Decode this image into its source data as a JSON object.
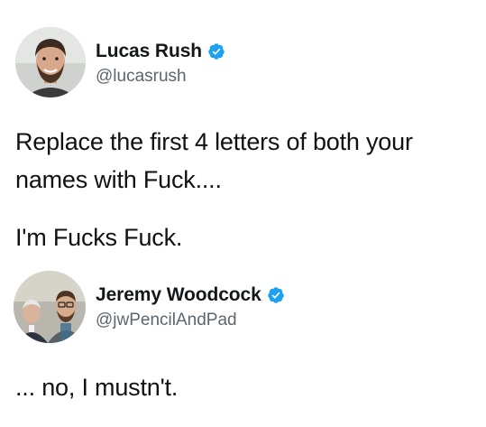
{
  "tweets": [
    {
      "display_name": "Lucas Rush",
      "handle": "@lucasrush",
      "verified": true,
      "paragraphs": [
        "Replace the first 4 letters of both your names with Fuck....",
        "I'm Fucks Fuck."
      ]
    },
    {
      "display_name": "Jeremy Woodcock",
      "handle": "@jwPencilAndPad",
      "verified": true,
      "paragraphs": [
        "... no, I mustn't."
      ]
    }
  ],
  "colors": {
    "verified_blue": "#1da1f2",
    "handle_gray": "#5b6670",
    "text": "#14171a"
  },
  "icons": {
    "verified": "verified-badge-icon"
  }
}
